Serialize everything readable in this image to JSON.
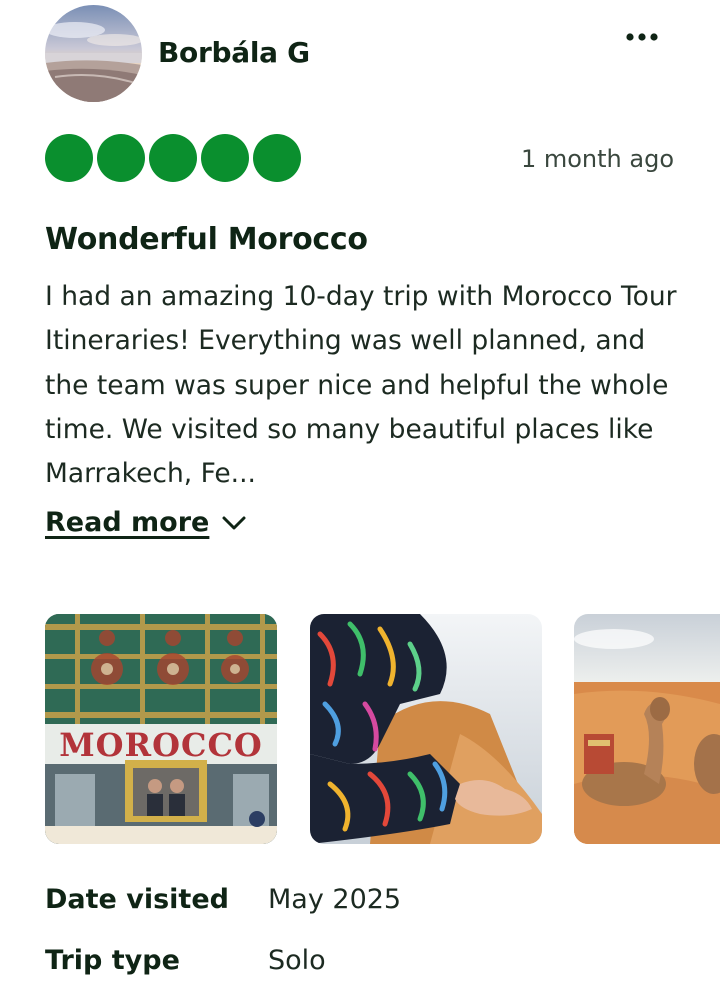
{
  "reviewer": {
    "name": "Borbála G",
    "avatar_icon": "beach-sunset-avatar"
  },
  "menu": {
    "icon": "more-horizontal-icon"
  },
  "review": {
    "rating": 5,
    "rating_max": 5,
    "rating_color": "#0a8f2e",
    "date": "1 month ago",
    "title": "Wonderful Morocco",
    "body": "I had an amazing 10-day trip with Morocco Tour Itineraries! Everything was well planned, and the team was super nice and helpful the whole time. We visited so many beautiful places like Marrakech, Fe...",
    "read_more_label": "Read more"
  },
  "photos": [
    {
      "name": "morocco-restaurant-photo",
      "sign_text": "MOROCCO"
    },
    {
      "name": "desert-walk-photo"
    },
    {
      "name": "camel-desert-photo"
    }
  ],
  "details": [
    {
      "label": "Date visited",
      "value": "May 2025"
    },
    {
      "label": "Trip type",
      "value": "Solo"
    }
  ]
}
